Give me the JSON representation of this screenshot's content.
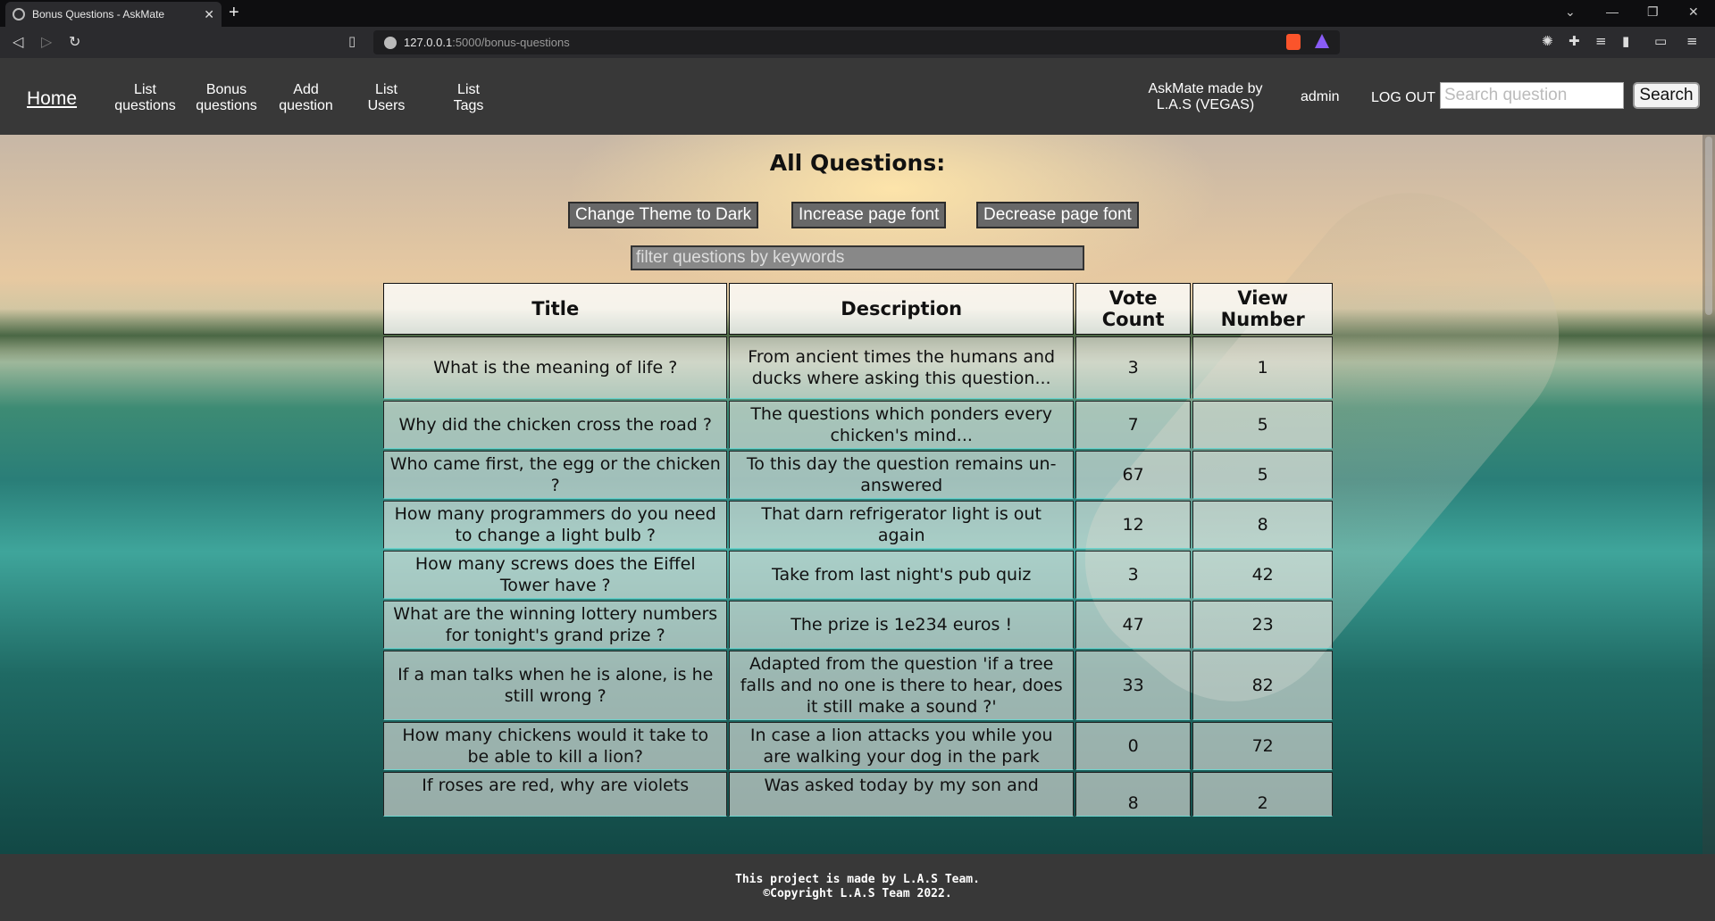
{
  "browser": {
    "tab_title": "Bonus Questions - AskMate",
    "url_host": "127.0.0.1",
    "url_path": ":5000/bonus-questions"
  },
  "nav": {
    "home": "Home",
    "links": [
      {
        "line1": "List",
        "line2": "questions"
      },
      {
        "line1": "Bonus",
        "line2": "questions"
      },
      {
        "line1": "Add",
        "line2": "question"
      },
      {
        "line1": "List",
        "line2": "Users"
      },
      {
        "line1": "List",
        "line2": "Tags"
      }
    ],
    "made_by_line1": "AskMate made by",
    "made_by_line2": "L.A.S (VEGAS)",
    "user": "admin",
    "logout": "LOG OUT",
    "search_placeholder": "Search question",
    "search_button": "Search"
  },
  "main": {
    "title": "All Questions:",
    "buttons": {
      "theme": "Change Theme to Dark",
      "increase": "Increase page font",
      "decrease": "Decrease page font"
    },
    "filter_placeholder": "filter questions by keywords",
    "table": {
      "headers": [
        "Title",
        "Description",
        "Vote Count",
        "View Number"
      ],
      "rows": [
        {
          "title": "What is the meaning of life ?",
          "desc": "From ancient times the humans and ducks where asking this question...",
          "votes": "3",
          "views": "1"
        },
        {
          "title": "Why did the chicken cross the road ?",
          "desc": "The questions which ponders every chicken's mind...",
          "votes": "7",
          "views": "5"
        },
        {
          "title": "Who came first, the egg or the chicken ?",
          "desc": "To this day the question remains un-answered",
          "votes": "67",
          "views": "5"
        },
        {
          "title": "How many programmers do you need to change a light bulb ?",
          "desc": "That darn refrigerator light is out again",
          "votes": "12",
          "views": "8"
        },
        {
          "title": "How many screws does the Eiffel Tower have ?",
          "desc": "Take from last night's pub quiz",
          "votes": "3",
          "views": "42"
        },
        {
          "title": "What are the winning lottery numbers for tonight's grand prize ?",
          "desc": "The prize is 1e234 euros !",
          "votes": "47",
          "views": "23"
        },
        {
          "title": "If a man talks when he is alone, is he still wrong ?",
          "desc": "Adapted from the question 'if a tree falls and no one is there to hear, does it still make a sound ?'",
          "votes": "33",
          "views": "82"
        },
        {
          "title": "How many chickens would it take to be able to kill a lion?",
          "desc": "In case a lion attacks you while you are walking your dog in the park",
          "votes": "0",
          "views": "72"
        },
        {
          "title": "If roses are red, why are violets",
          "desc": "Was asked today by my son and",
          "votes": "8",
          "views": "2"
        }
      ]
    }
  },
  "footer": {
    "line1": "This project is made by L.A.S Team.",
    "line2": "©Copyright L.A.S Team 2022."
  }
}
